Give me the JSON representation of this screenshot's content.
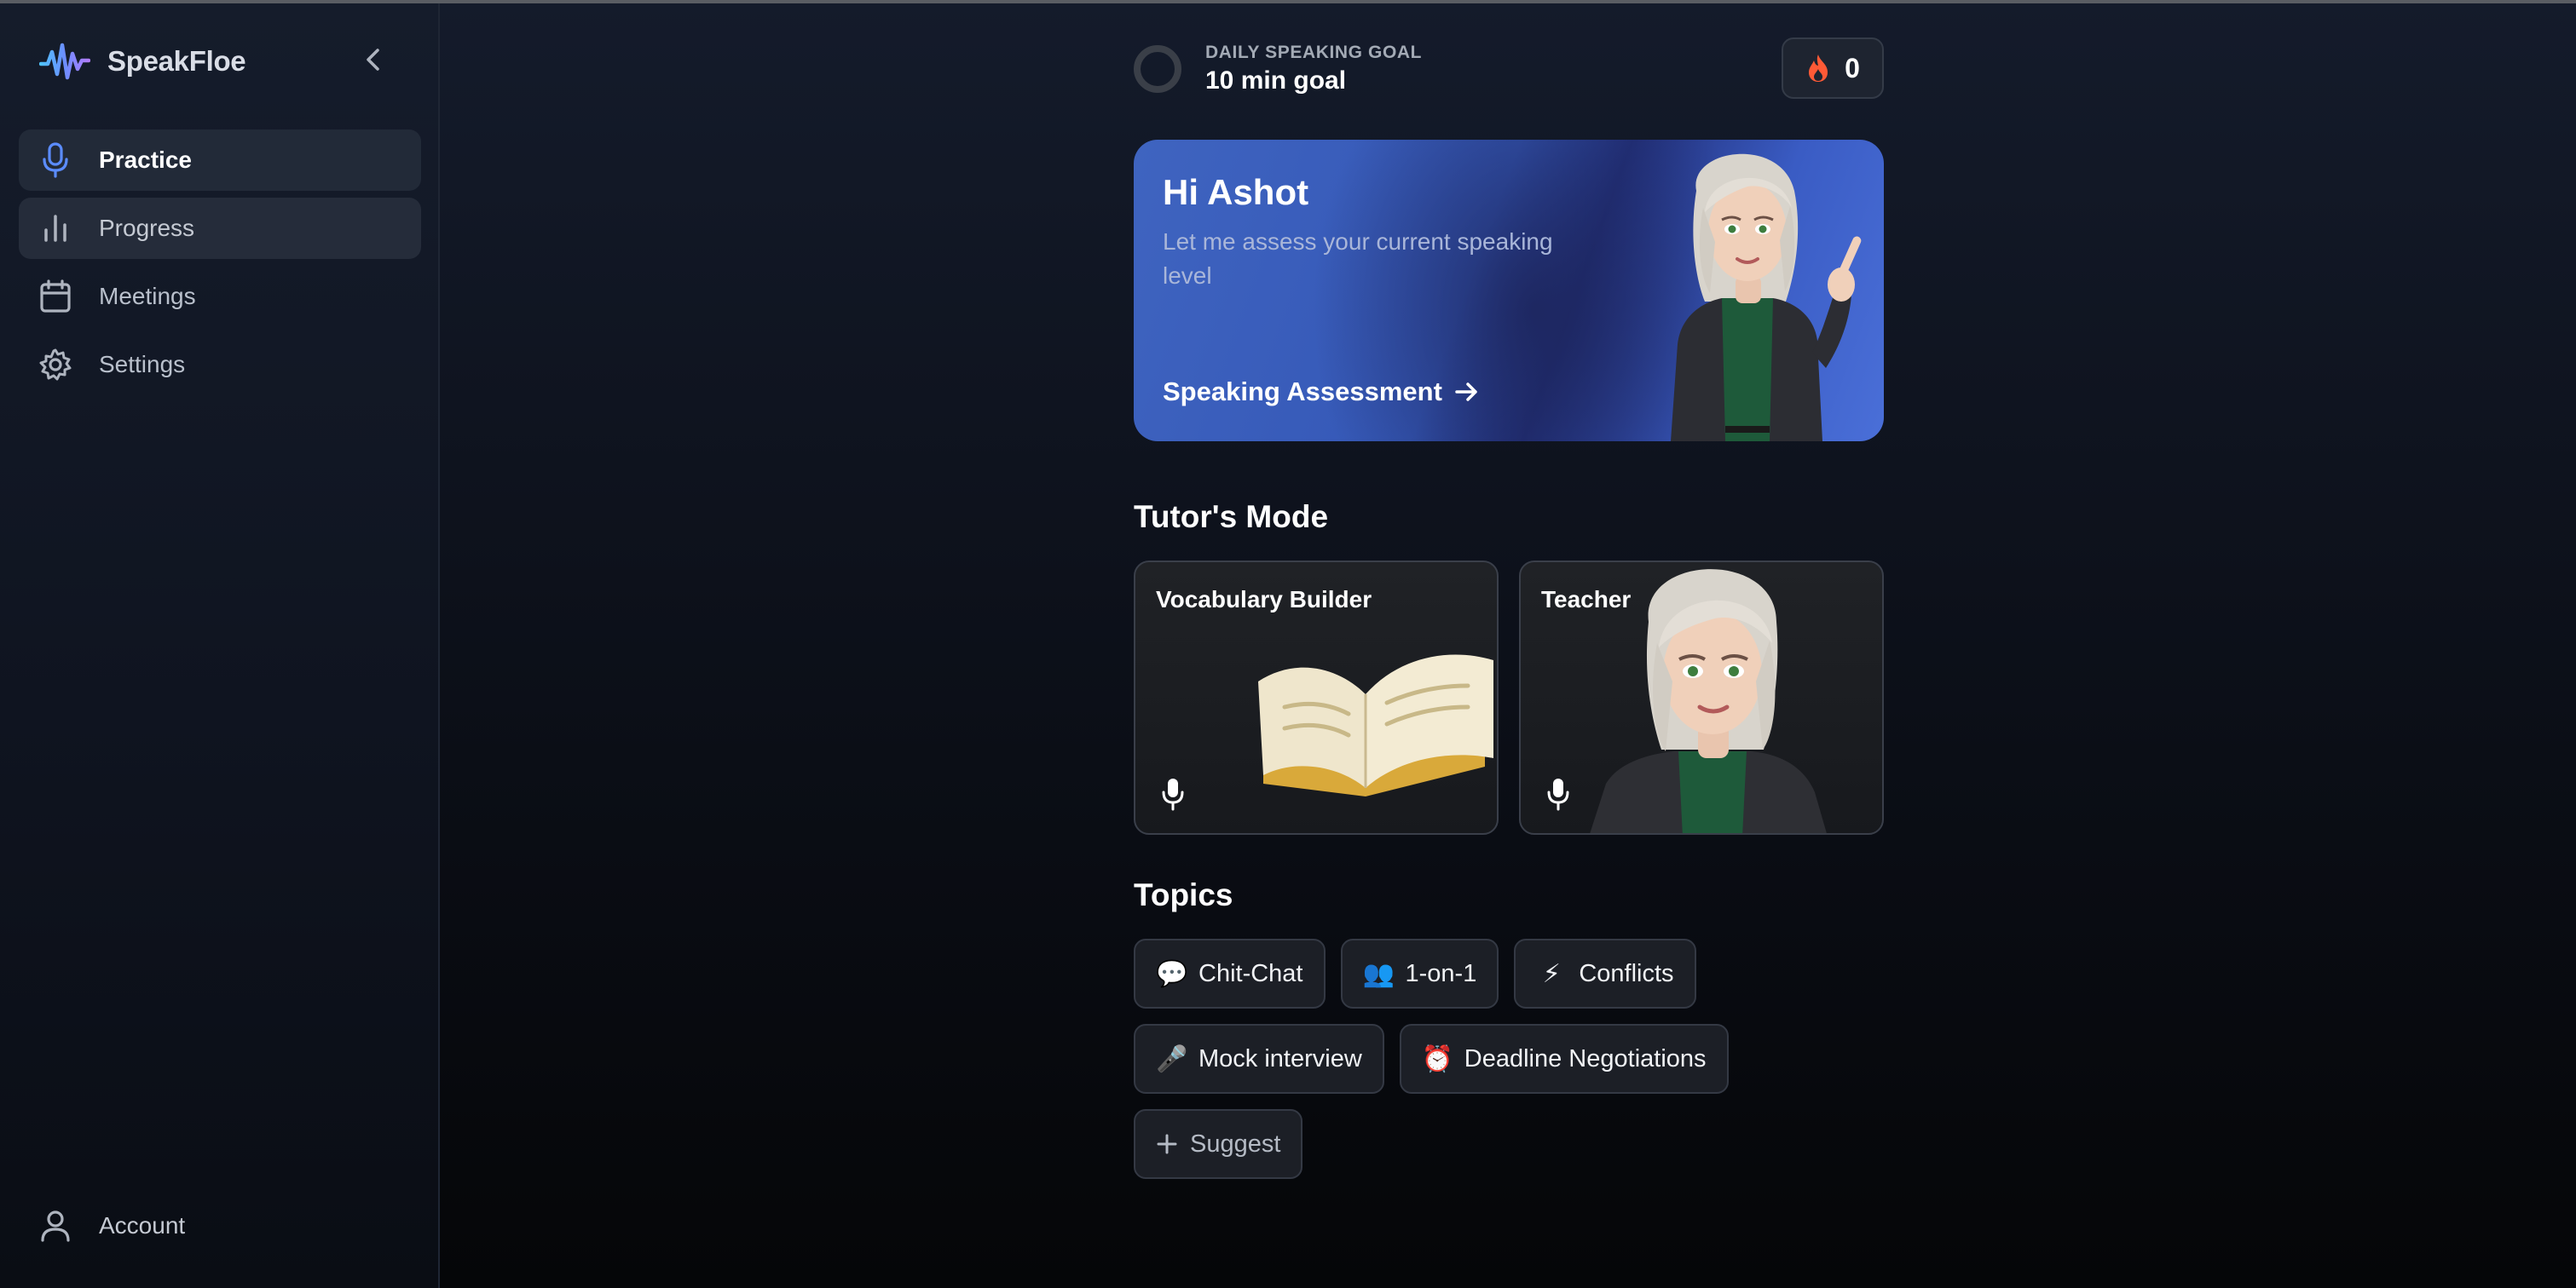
{
  "app": {
    "name": "SpeakFloe"
  },
  "sidebar": {
    "items": [
      {
        "label": "Practice",
        "icon": "microphone-icon",
        "state": "active"
      },
      {
        "label": "Progress",
        "icon": "bar-chart-icon",
        "state": "hover"
      },
      {
        "label": "Meetings",
        "icon": "calendar-icon",
        "state": "default"
      },
      {
        "label": "Settings",
        "icon": "gear-icon",
        "state": "default"
      }
    ],
    "account_label": "Account"
  },
  "goal": {
    "label": "DAILY SPEAKING GOAL",
    "value": "10 min goal",
    "progress": 0
  },
  "streak": {
    "count": "0",
    "icon": "flame-icon"
  },
  "hero": {
    "title": "Hi Ashot",
    "subtitle": "Let me assess your current speaking level",
    "cta_label": "Speaking Assessment"
  },
  "tutor_mode": {
    "title": "Tutor's Mode",
    "cards": [
      {
        "label": "Vocabulary Builder",
        "icon": "open-book-image"
      },
      {
        "label": "Teacher",
        "icon": "teacher-avatar-image"
      }
    ]
  },
  "topics": {
    "title": "Topics",
    "chips": [
      {
        "emoji": "💬",
        "label": "Chit-Chat"
      },
      {
        "emoji": "👥",
        "label": "1-on-1"
      },
      {
        "emoji": "⚡",
        "label": "Conflicts"
      },
      {
        "emoji": "🎤",
        "label": "Mock interview"
      },
      {
        "emoji": "⏰",
        "label": "Deadline Negotiations"
      }
    ],
    "suggest_label": "Suggest"
  },
  "colors": {
    "accent_blue": "#3f64c0",
    "flame": "#ff5a36",
    "background": "#0d111b"
  }
}
